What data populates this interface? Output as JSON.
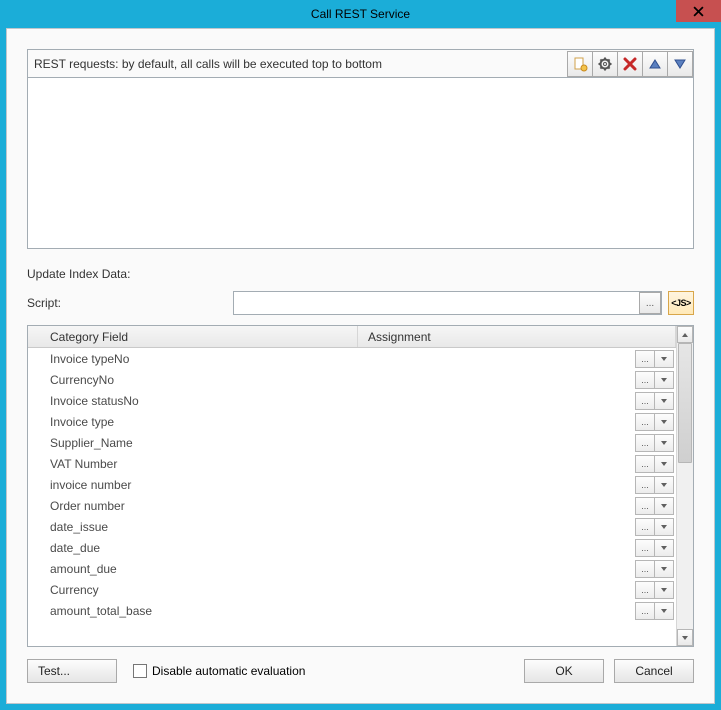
{
  "window": {
    "title": "Call REST Service"
  },
  "rest_panel": {
    "header_text": "REST requests: by default, all calls will be executed top to bottom"
  },
  "toolbar_icons": {
    "new": "new-doc-icon",
    "settings": "gear-icon",
    "delete": "delete-x-icon",
    "move_up": "triangle-up-icon",
    "move_down": "triangle-down-icon"
  },
  "update_section_label": "Update Index Data:",
  "script_row": {
    "label": "Script:",
    "value": "",
    "browse_label": "...",
    "js_label": "<JS>"
  },
  "table": {
    "columns": {
      "col1": "Category Field",
      "col2": "Assignment"
    },
    "rows": [
      {
        "field": "Invoice typeNo"
      },
      {
        "field": "CurrencyNo"
      },
      {
        "field": "Invoice statusNo"
      },
      {
        "field": "Invoice type"
      },
      {
        "field": "Supplier_Name"
      },
      {
        "field": "VAT Number"
      },
      {
        "field": "invoice number"
      },
      {
        "field": "Order number"
      },
      {
        "field": "date_issue"
      },
      {
        "field": "date_due"
      },
      {
        "field": "amount_due"
      },
      {
        "field": "Currency"
      },
      {
        "field": "amount_total_base"
      }
    ],
    "cell_browse_label": "...",
    "cell_dropdown_label": "▾"
  },
  "footer": {
    "test_label": "Test...",
    "checkbox_label": "Disable automatic evaluation",
    "ok_label": "OK",
    "cancel_label": "Cancel"
  },
  "colors": {
    "title_bg": "#1badd8",
    "close_bg": "#c75050"
  }
}
